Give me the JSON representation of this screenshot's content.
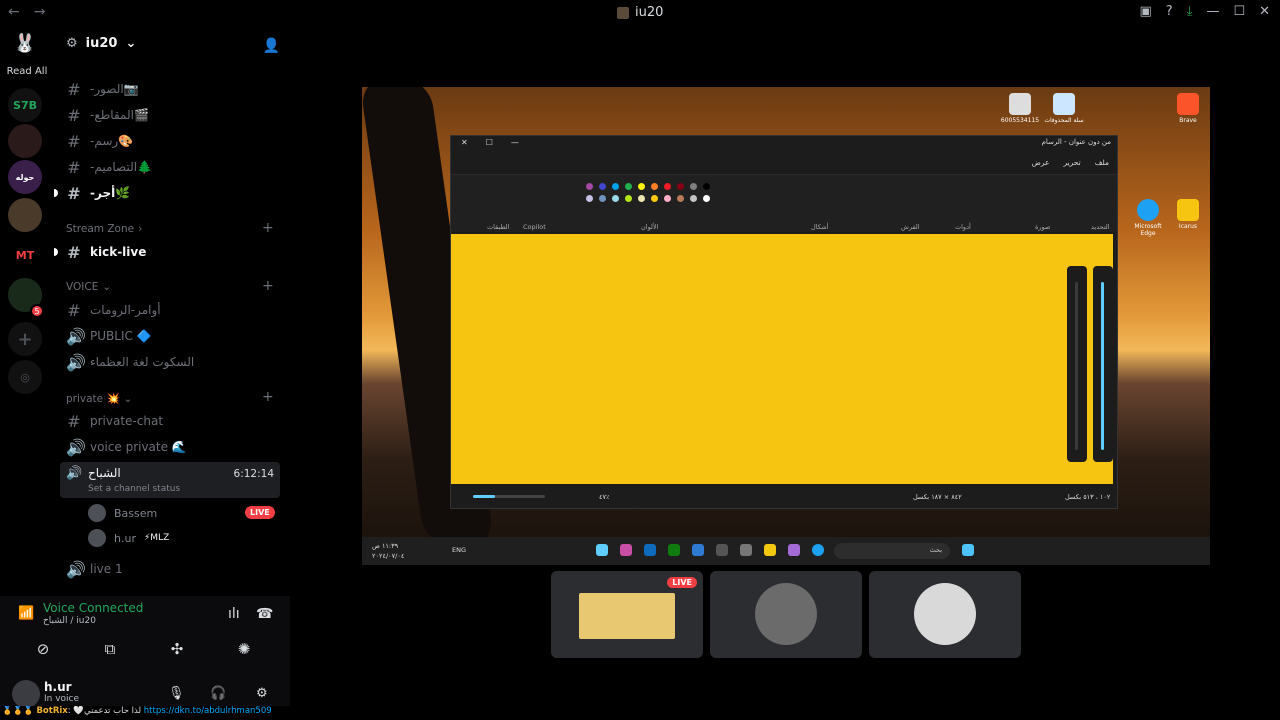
{
  "titlebar": {
    "title": "iu20"
  },
  "rail": {
    "read_all": "Read All",
    "badge": "5",
    "s1": "S7B",
    "s2": "MT"
  },
  "server": {
    "name": "iu20"
  },
  "channels_top": [
    "-الصور📷",
    "-المقاطع🎬",
    "-رسم🎨",
    "-التصاميم🌲",
    "-أجر🌿"
  ],
  "stream_zone": {
    "label": "Stream Zone",
    "channel": "kick-live"
  },
  "voice_cat": {
    "label": "VOICE",
    "channels": [
      "أوامر-الرومات",
      "PUBLIC 🔷",
      "السكوت لغة العظماء"
    ]
  },
  "private_cat": {
    "label": "private 💥",
    "channels": [
      "private-chat",
      "voice private 🌊"
    ]
  },
  "active_vc": {
    "name": "الشباح",
    "time": "6:12:14",
    "status": "Set a channel status",
    "users": [
      {
        "name": "Bassem",
        "live": "LIVE"
      },
      {
        "name": "h.ur",
        "tag": "⚡MLZ"
      }
    ]
  },
  "live1": "live 1",
  "voice_panel": {
    "connected": "Voice Connected",
    "sub": "الشباح / iu20"
  },
  "user": {
    "name": "h.ur",
    "status": "In voice"
  },
  "ticker": {
    "prefix": "🏅🏅🏅 ",
    "bot": "BotRix",
    "text": ": 🤍لذا حاب تدعمني ",
    "link": "https://dkn.to/abdulrhman509"
  },
  "paint": {
    "title": "من دون عنوان - الرسام",
    "menu": [
      "ملف",
      "تحرير",
      "عرض"
    ],
    "groups": [
      "التحديد",
      "صورة",
      "أدوات",
      "الفرش",
      "أشكال",
      "الألوان",
      "Copilot",
      "الطبقات"
    ],
    "status_left": "١٠٢ ، ٥١٣ بكسل",
    "status_mid": "٨٤٢ × ١٨٧ بكسل",
    "zoom": "٤٧٪"
  },
  "desktop_icons": [
    "6005534115",
    "سلة المحذوفات",
    "Brave",
    "Microsoft Edge",
    "Icarus"
  ],
  "taskbar": {
    "search": "بحث",
    "lang": "ENG",
    "clock": "١١:٣٩ ص",
    "date": "٢٠٢٤/٠٧/٠٤"
  },
  "tiles": {
    "live": "LIVE"
  },
  "colors": {
    "accent_green": "#23a55a",
    "live_red": "#f23f43",
    "canvas_yellow": "#f6c511"
  }
}
